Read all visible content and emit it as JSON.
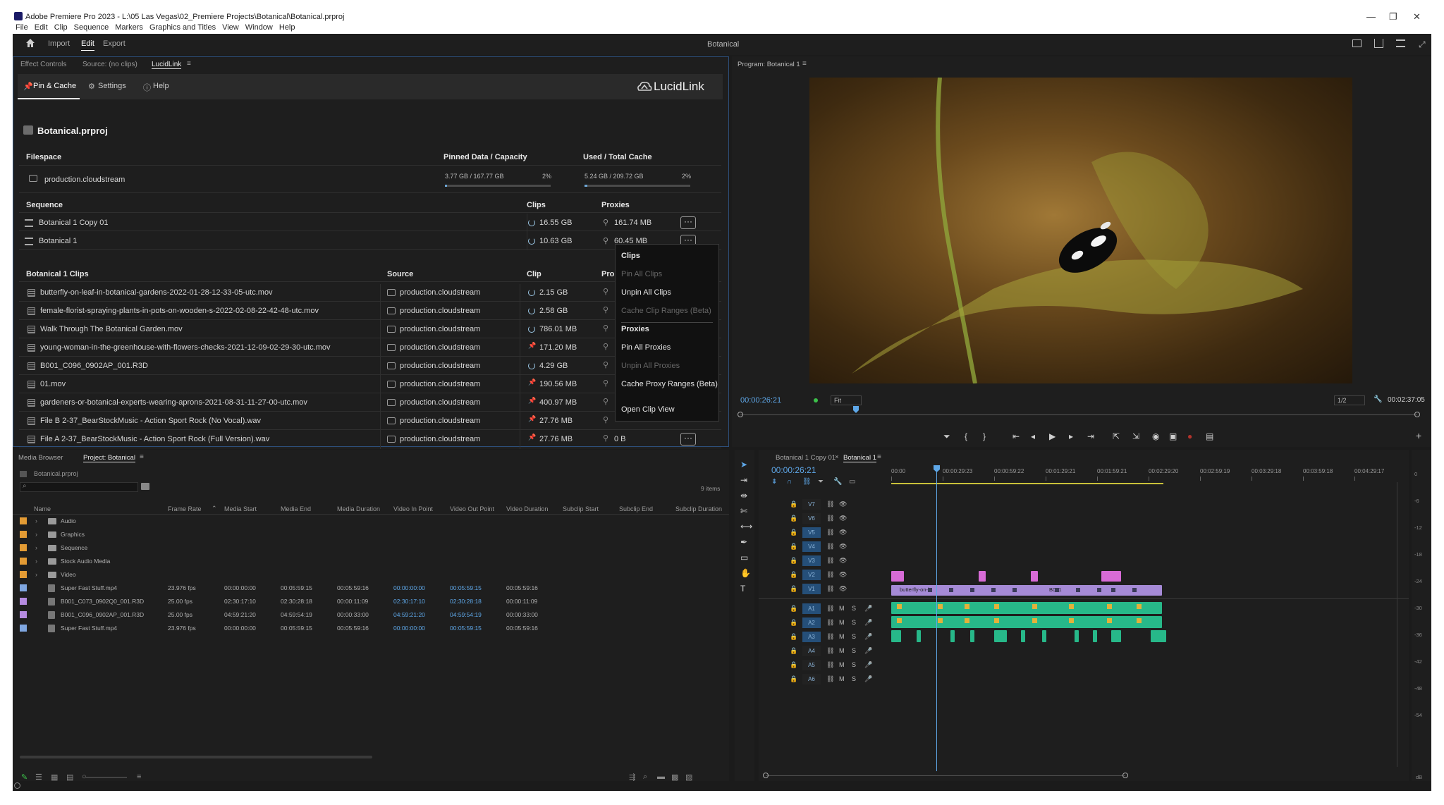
{
  "window": {
    "title": "Adobe Premiere Pro 2023 - L:\\05 Las Vegas\\02_Premiere Projects\\Botanical\\Botanical.prproj",
    "menu": [
      "File",
      "Edit",
      "Clip",
      "Sequence",
      "Markers",
      "Graphics and Titles",
      "View",
      "Window",
      "Help"
    ],
    "controls": [
      "—",
      "❐",
      "✕"
    ]
  },
  "topnav": {
    "tabs": [
      "Import",
      "Edit",
      "Export"
    ],
    "active": "Edit",
    "project_name": "Botanical"
  },
  "left_top_tabs": [
    "Effect Controls",
    "Source: (no clips)",
    "LucidLink"
  ],
  "lucid": {
    "tabs": [
      "Pin & Cache",
      "Settings",
      "Help"
    ],
    "brand": "LucidLink",
    "project": "Botanical.prproj",
    "filespace": {
      "header": "Filespace",
      "pinned_header": "Pinned Data / Capacity",
      "cache_header": "Used / Total Cache",
      "name": "production.cloudstream",
      "pinned": "3.77 GB / 167.77 GB",
      "pinned_pct": "2%",
      "pinned_fill": 0.02,
      "cache": "5.24 GB / 209.72 GB",
      "cache_pct": "2%",
      "cache_fill": 0.025
    },
    "sequence": {
      "header": "Sequence",
      "clips_header": "Clips",
      "proxies_header": "Proxies",
      "rows": [
        {
          "name": "Botanical 1 Copy 01",
          "clips": "16.55 GB",
          "proxies": "161.74 MB"
        },
        {
          "name": "Botanical 1",
          "clips": "10.63 GB",
          "proxies": "60.45 MB"
        }
      ]
    },
    "clips": {
      "header": "Botanical 1 Clips",
      "source_header": "Source",
      "clip_header": "Clip",
      "proxy_header": "Pro",
      "rows": [
        {
          "name": "butterfly-on-leaf-in-botanical-gardens-2022-01-28-12-33-05-utc.mov",
          "source": "production.cloudstream",
          "size": "2.15 GB",
          "state": "spin"
        },
        {
          "name": "female-florist-spraying-plants-in-pots-on-wooden-s-2022-02-08-22-42-48-utc.mov",
          "source": "production.cloudstream",
          "size": "2.58 GB",
          "state": "spin"
        },
        {
          "name": "Walk Through The Botanical Garden.mov",
          "source": "production.cloudstream",
          "size": "786.01 MB",
          "state": "spin"
        },
        {
          "name": "young-woman-in-the-greenhouse-with-flowers-checks-2021-12-09-02-29-30-utc.mov",
          "source": "production.cloudstream",
          "size": "171.20 MB",
          "state": "pin"
        },
        {
          "name": "B001_C096_0902AP_001.R3D",
          "source": "production.cloudstream",
          "size": "4.29 GB",
          "state": "spin"
        },
        {
          "name": "01.mov",
          "source": "production.cloudstream",
          "size": "190.56 MB",
          "state": "pin"
        },
        {
          "name": "gardeners-or-botanical-experts-wearing-aprons-2021-08-31-11-27-00-utc.mov",
          "source": "production.cloudstream",
          "size": "400.97 MB",
          "state": "pin"
        },
        {
          "name": "File B 2-37_BearStockMusic - Action Sport Rock (No Vocal).wav",
          "source": "production.cloudstream",
          "size": "27.76 MB",
          "state": "pin"
        },
        {
          "name": "File A 2-37_BearStockMusic - Action Sport Rock (Full Version).wav",
          "source": "production.cloudstream",
          "size": "27.76 MB",
          "state": "pin",
          "proxy": "0 B"
        }
      ]
    },
    "context_menu": {
      "items": [
        {
          "label": "Clips",
          "kind": "header"
        },
        {
          "label": "Pin All Clips",
          "kind": "disabled"
        },
        {
          "label": "Unpin All Clips",
          "kind": "item"
        },
        {
          "label": "Cache Clip Ranges (Beta)",
          "kind": "disabled"
        },
        {
          "label": "Proxies",
          "kind": "header"
        },
        {
          "label": "Pin All Proxies",
          "kind": "item"
        },
        {
          "label": "Unpin All Proxies",
          "kind": "disabled"
        },
        {
          "label": "Cache Proxy Ranges (Beta)",
          "kind": "item"
        },
        {
          "label": "Open Clip View",
          "kind": "item"
        }
      ]
    }
  },
  "program": {
    "title": "Program: Botanical 1",
    "timecode": "00:00:26:21",
    "fit": "Fit",
    "resolution": "1/2",
    "duration": "00:02:37:05"
  },
  "project_panel": {
    "tabs": [
      "Media Browser",
      "Project: Botanical"
    ],
    "path": "Botanical.prproj",
    "item_count": "9 items",
    "columns": [
      "Name",
      "Frame Rate",
      "Media Start",
      "Media End",
      "Media Duration",
      "Video In Point",
      "Video Out Point",
      "Video Duration",
      "Subclip Start",
      "Subclip End",
      "Subclip Duration"
    ],
    "folders": [
      "Audio",
      "Graphics",
      "Sequence",
      "Stock Audio Media",
      "Video"
    ],
    "items": [
      {
        "name": "Super Fast Stuff.mp4",
        "fps": "23.976 fps",
        "start": "00:00:00:00",
        "end": "00:05:59:15",
        "dur": "00:05:59:16",
        "in": "00:00:00:00",
        "out": "00:05:59:15",
        "vdur": "00:05:59:16",
        "color": "#7fa6e0"
      },
      {
        "name": "B001_C073_0902Q0_001.R3D",
        "fps": "25.00 fps",
        "start": "02:30:17:10",
        "end": "02:30:28:18",
        "dur": "00:00:11:09",
        "in": "02:30:17:10",
        "out": "02:30:28:18",
        "vdur": "00:00:11:09",
        "color": "#b58be0"
      },
      {
        "name": "B001_C096_0902AP_001.R3D",
        "fps": "25.00 fps",
        "start": "04:59:21:20",
        "end": "04:59:54:19",
        "dur": "00:00:33:00",
        "in": "04:59:21:20",
        "out": "04:59:54:19",
        "vdur": "00:00:33:00",
        "color": "#b58be0"
      },
      {
        "name": "Super Fast Stuff.mp4",
        "fps": "23.976 fps",
        "start": "00:00:00:00",
        "end": "00:05:59:15",
        "dur": "00:05:59:16",
        "in": "00:00:00:00",
        "out": "00:05:59:15",
        "vdur": "00:05:59:16",
        "color": "#7fa6e0"
      }
    ]
  },
  "timeline": {
    "tabs": [
      "Botanical 1 Copy 01",
      "Botanical 1"
    ],
    "timecode": "00:00:26:21",
    "ruler": [
      "00:00",
      "00:00:29:23",
      "00:00:59:22",
      "00:01:29:21",
      "00:01:59:21",
      "00:02:29:20",
      "00:02:59:19",
      "00:03:29:18",
      "00:03:59:18",
      "00:04:29:17"
    ],
    "video_tracks": [
      "V7",
      "V6",
      "V5",
      "V4",
      "V3",
      "V2",
      "V1"
    ],
    "audio_tracks": [
      "A1",
      "A2",
      "A3",
      "A4",
      "A5",
      "A6"
    ],
    "clip_label": "butterfly-on-le",
    "clip_label2": "B001",
    "meter_ticks": [
      "0",
      "-6",
      "-12",
      "-18",
      "-24",
      "-30",
      "-36",
      "-42",
      "-48",
      "-54"
    ],
    "meter_db": "dB"
  }
}
